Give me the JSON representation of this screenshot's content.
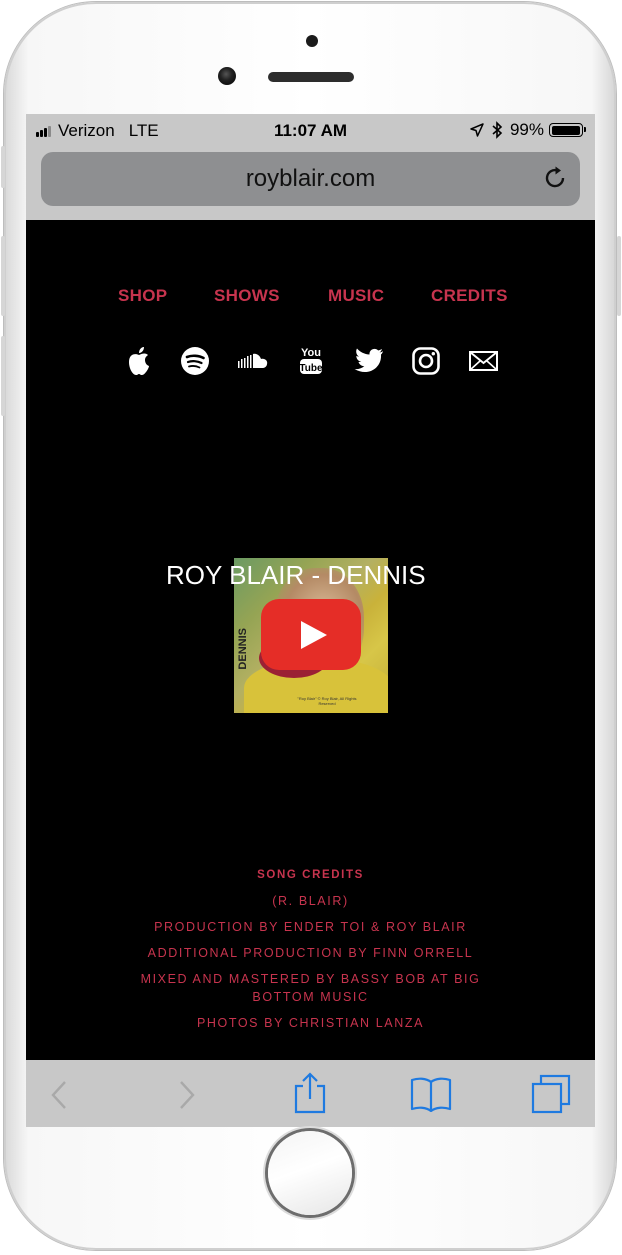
{
  "status_bar": {
    "carrier": "Verizon",
    "network": "LTE",
    "time": "11:07 AM",
    "battery_percent": "99%",
    "battery_level": 0.99
  },
  "browser": {
    "url": "royblair.com"
  },
  "nav": {
    "items": [
      {
        "label": "SHOP"
      },
      {
        "label": "SHOWS"
      },
      {
        "label": "MUSIC"
      },
      {
        "label": "CREDITS"
      }
    ]
  },
  "social_icons": [
    "apple-icon",
    "spotify-icon",
    "soundcloud-icon",
    "youtube-icon",
    "twitter-icon",
    "instagram-icon",
    "mail-icon"
  ],
  "video": {
    "title": "ROY BLAIR - DENNIS",
    "thumb_side_text": "DENNIS",
    "thumb_fine_print": "\"Roy Blair\" © Roy Blair, All Rights Reserved"
  },
  "credits": {
    "heading": "SONG CREDITS",
    "lines": [
      "(R. BLAIR)",
      "PRODUCTION BY ENDER TOI & ROY BLAIR",
      "ADDITIONAL PRODUCTION BY FINN ORRELL",
      "MIXED AND MASTERED BY BASSY BOB AT BIG BOTTOM MUSIC",
      "PHOTOS BY CHRISTIAN LANZA"
    ]
  },
  "colors": {
    "accent": "#c7344e",
    "page_background": "#000000",
    "browser_chrome": "#c8c8c8",
    "ios_blue": "#1f7ae0"
  }
}
